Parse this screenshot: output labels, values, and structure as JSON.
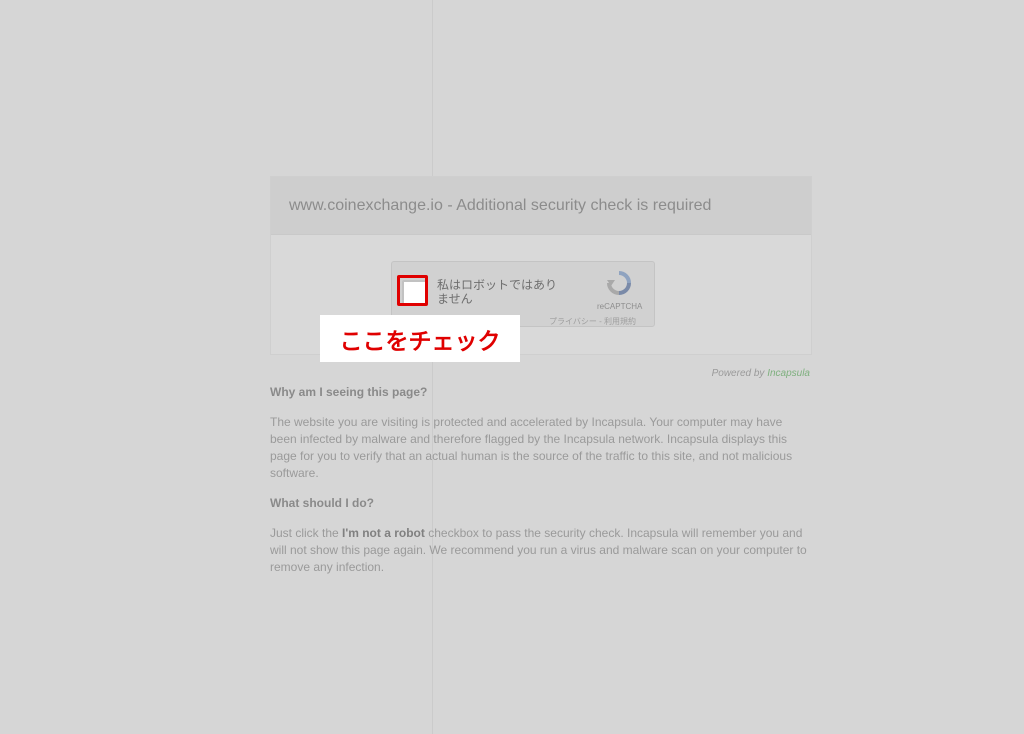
{
  "card": {
    "title": "www.coinexchange.io - Additional security check is required"
  },
  "recaptcha": {
    "label": "私はロボットではありません",
    "brand": "reCAPTCHA",
    "privacy_link": "プライバシー",
    "separator": " - ",
    "terms_link": "利用規約"
  },
  "callout": {
    "text": "ここをチェック",
    "color": "#e00000"
  },
  "powered": {
    "prefix": "Powered by ",
    "brand": "Incapsula"
  },
  "content": {
    "why_heading": "Why am I seeing this page?",
    "why_text": "The website you are visiting is protected and accelerated by Incapsula. Your computer may have been infected by malware and therefore flagged by the Incapsula network. Incapsula displays this page for you to verify that an actual human is the source of the traffic to this site, and not malicious software.",
    "what_heading": "What should I do?",
    "what_text_1": "Just click the ",
    "what_text_bold": "I'm not a robot",
    "what_text_2": " checkbox to pass the security check. Incapsula will remember you and will not show this page again. We recommend you run a virus and malware scan on your computer to remove any infection."
  }
}
